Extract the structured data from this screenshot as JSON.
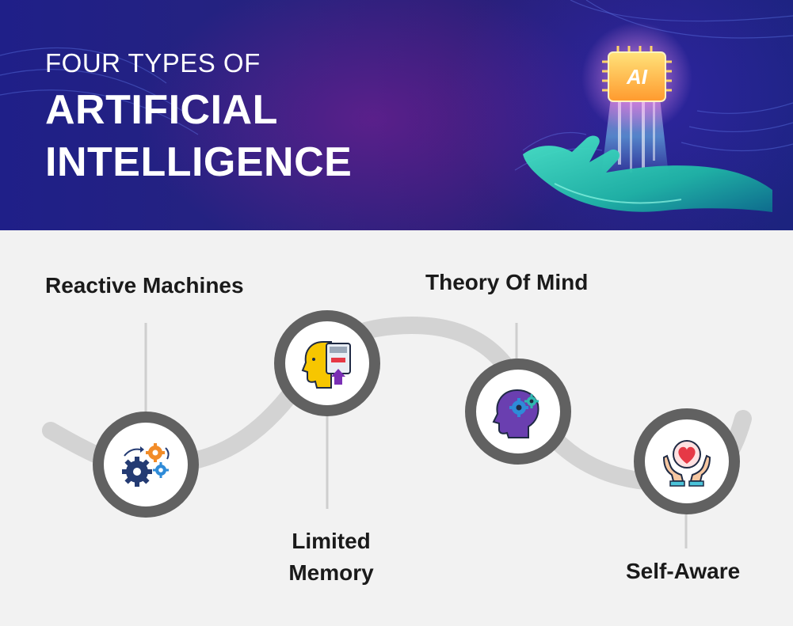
{
  "header": {
    "title_line1": "FOUR TYPES OF",
    "title_line2": "ARTIFICIAL",
    "title_line3": "INTELLIGENCE",
    "chip_text": "AI"
  },
  "types": [
    {
      "label": "Reactive Machines",
      "icon": "gears-icon"
    },
    {
      "label_line1": "Limited",
      "label_line2": "Memory",
      "icon": "head-memory-card-icon"
    },
    {
      "label": "Theory Of Mind",
      "icon": "head-gears-icon"
    },
    {
      "label": "Self-Aware",
      "icon": "hands-heart-icon"
    }
  ],
  "colors": {
    "banner_blue": "#1f1f88",
    "banner_purple": "#6b1f8a",
    "path_gray": "#d3d3d3",
    "node_ring": "#616161",
    "connector": "#cfcfcf",
    "background": "#f2f2f2"
  }
}
